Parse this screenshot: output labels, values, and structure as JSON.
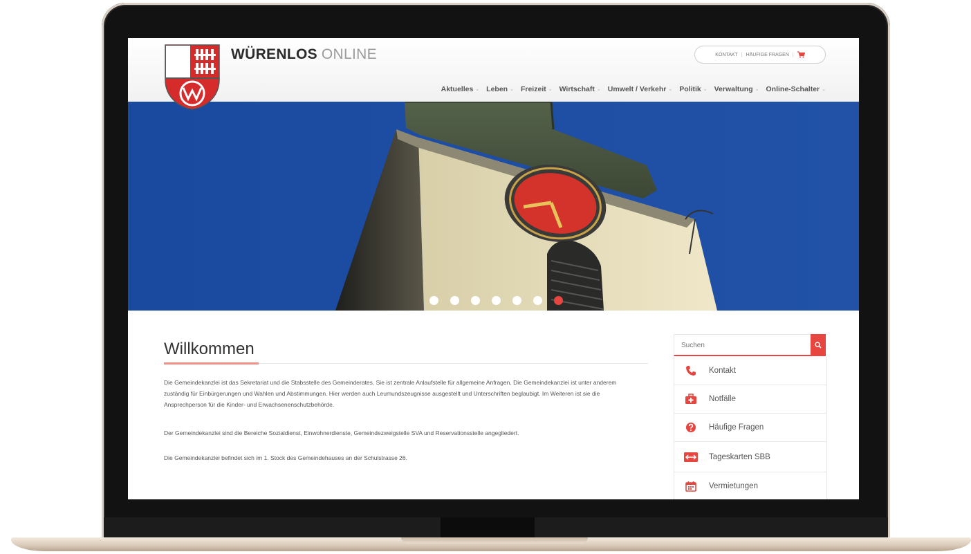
{
  "site": {
    "brand_strong": "WÜRENLOS",
    "brand_light": "ONLINE"
  },
  "topbar": {
    "items": [
      "KONTAKT",
      "HÄUFIGE FRAGEN"
    ],
    "separator": "|",
    "cart_icon": "shopping-cart-icon"
  },
  "nav": {
    "items": [
      "Aktuelles",
      "Leben",
      "Freizeit",
      "Wirtschaft",
      "Umwelt / Verkehr",
      "Politik",
      "Verwaltung",
      "Online-Schalter"
    ],
    "caret": "⌄"
  },
  "hero": {
    "slide_count": 7,
    "active_slide": 7
  },
  "content": {
    "title": "Willkommen",
    "paragraphs": [
      "Die Gemeindekanzlei ist das Sekretariat und die Stabsstelle des Gemeinderates. Sie ist zentrale Anlaufstelle für allgemeine Anfragen. Die Gemeindekanzlei ist unter anderem zuständig für Einbürgerungen und Wahlen und Abstimmungen. Hier werden auch Leumundszeugnisse ausgestellt und Unterschriften beglaubigt. Im Weiteren ist sie die Ansprechperson für die Kinder- und Erwachsenenschutzbehörde.",
      "Der Gemeindekanzlei sind die Bereiche Sozialdienst, Einwohnerdienste, Gemeindezweigstelle SVA und Reservationsstelle angegliedert.",
      "Die Gemeindekanzlei befindet sich im 1. Stock des Gemeindehauses an der Schulstrasse 26."
    ]
  },
  "sidebar": {
    "search_placeholder": "Suchen",
    "items": [
      {
        "label": "Kontakt",
        "icon": "phone-icon"
      },
      {
        "label": "Notfälle",
        "icon": "first-aid-icon"
      },
      {
        "label": "Häufige Fragen",
        "icon": "question-icon"
      },
      {
        "label": "Tageskarten SBB",
        "icon": "sbb-ticket-icon"
      },
      {
        "label": "Vermietungen",
        "icon": "calendar-icon"
      }
    ]
  },
  "colors": {
    "accent": "#e6463f",
    "sky": "#1f4fa3"
  }
}
